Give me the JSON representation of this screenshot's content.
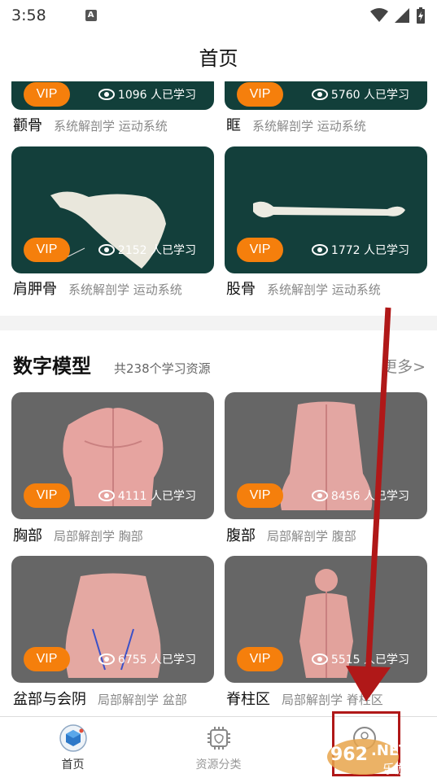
{
  "status_bar": {
    "time": "3:58",
    "notif_letter": "A"
  },
  "header": {
    "title": "首页"
  },
  "top_cards": [
    {
      "name": "颧骨",
      "tags": "系统解剖学 运动系统",
      "vip": "VIP",
      "views": "1096 人已学习"
    },
    {
      "name": "眶",
      "tags": "系统解剖学 运动系统",
      "vip": "VIP",
      "views": "5760 人已学习"
    },
    {
      "name": "肩胛骨",
      "tags": "系统解剖学 运动系统",
      "vip": "VIP",
      "views": "2152 人已学习"
    },
    {
      "name": "股骨",
      "tags": "系统解剖学 运动系统",
      "vip": "VIP",
      "views": "1772 人已学习"
    }
  ],
  "digital_section": {
    "title": "数字模型",
    "subtitle": "共238个学习资源",
    "more": "更多>",
    "cards": [
      {
        "name": "胸部",
        "tags": "局部解剖学 胸部",
        "vip": "VIP",
        "views": "4111 人已学习"
      },
      {
        "name": "腹部",
        "tags": "局部解剖学 腹部",
        "vip": "VIP",
        "views": "8456 人已学习"
      },
      {
        "name": "盆部与会阴",
        "tags": "局部解剖学 盆部",
        "vip": "VIP",
        "views": "6755 人已学习"
      },
      {
        "name": "脊柱区",
        "tags": "局部解剖学 脊柱区",
        "vip": "VIP",
        "views": "5515 人已学习"
      }
    ]
  },
  "tab_bar": {
    "tabs": [
      {
        "label": "首页",
        "icon": "home-cube-icon"
      },
      {
        "label": "资源分类",
        "icon": "chip-category-icon"
      },
      {
        "label": "",
        "icon": "profile-icon"
      }
    ]
  },
  "watermark": {
    "text_top": "962.NET",
    "text_bottom": "乐游网"
  },
  "colors": {
    "vip": "#f57f0c",
    "photo_bg": "#123f3a",
    "model_bg": "#666666",
    "annotation": "#b01818"
  }
}
